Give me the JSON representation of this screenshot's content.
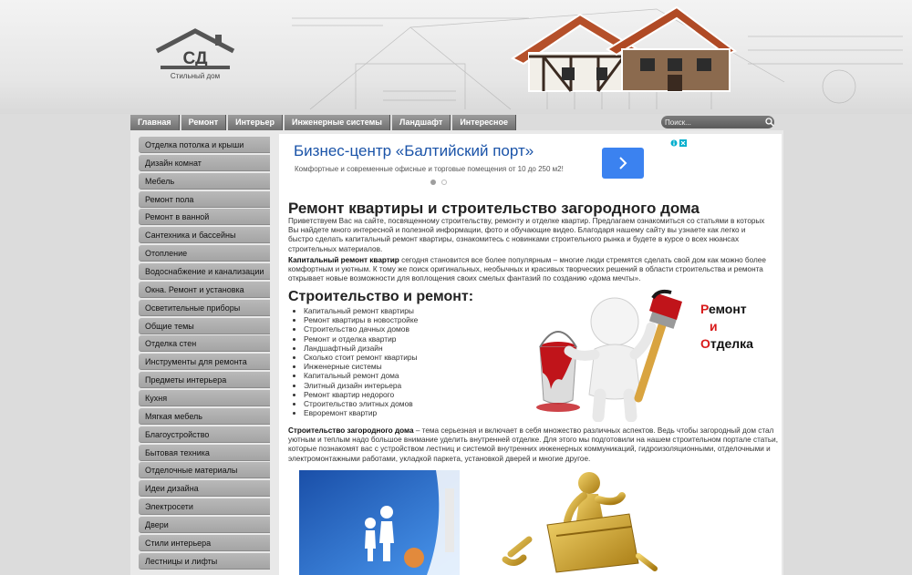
{
  "logo": {
    "text": "Стильный дом",
    "initials": "СД"
  },
  "nav": {
    "items": [
      "Главная",
      "Ремонт",
      "Интерьер",
      "Инженерные системы",
      "Ландшафт",
      "Интересное"
    ]
  },
  "search": {
    "placeholder": "Поиск..."
  },
  "sidebar": {
    "items": [
      "Отделка потолка и крыши",
      "Дизайн комнат",
      "Мебель",
      "Ремонт пола",
      "Ремонт в ванной",
      "Сантехника и бассейны",
      "Отопление",
      "Водоснабжение и канализации",
      "Окна. Ремонт и установка",
      "Осветительные приборы",
      "Общие темы",
      "Отделка стен",
      "Инструменты для ремонта",
      "Предметы интерьера",
      "Кухня",
      "Мягкая мебель",
      "Благоустройство",
      "Бытовая техника",
      "Отделочные материалы",
      "Идеи дизайна",
      "Электросети",
      "Двери",
      "Стили интерьера",
      "Лестницы и лифты"
    ]
  },
  "ad": {
    "title": "Бизнес-центр «Балтийский порт»",
    "description": "Комфортные и современные офисные и торговые помещения от 10 до 250 м2!"
  },
  "article": {
    "title": "Ремонт квартиры и строительство загородного дома",
    "intro": " Приветствуем Вас на сайте, посвященному строительству, ремонту и отделке квартир. Предлагаем ознакомиться со статьями в которых Вы найдете много интересной и полезной информации, фото и обучающие видео. Благодаря нашему сайту вы узнаете как легко и быстро сделать капитальный ремонт квартиры, ознакомитесь с новинками строительного рынка и будете в курсе о всех нюансах строительных материалов.",
    "p2_bold": "Капитальный ремонт квартир",
    "p2_text": " сегодня становится все более популярным – многие люди стремятся сделать свой дом как можно более комфортным и уютным. К тому же поиск оригинальных, необычных и красивых творческих решений в области строительства и ремонта открывает новые возможности для воплощения своих смелых фантазий по созданию «дома мечты».",
    "section_title": "Строительство и ремонт:",
    "links": [
      "Капитальный ремонт квартиры",
      "Ремонт квартиры в новостройке",
      "Строительство дачных домов",
      "Ремонт и отделка квартир",
      "Ландшафтный дизайн",
      "Сколько стоит ремонт квартиры",
      "Инженерные системы",
      "Капитальный ремонт дома",
      "Элитный дизайн интерьера",
      "Ремонт квартир недорого",
      "Строительство элитных домов",
      "Евроремонт квартир"
    ],
    "p3_bold": "Строительство загородного дома",
    "p3_text": "– тема серьезная и включает в себя множество различных аспектов. Ведь чтобы загородный дом стал уютным и теплым надо большое внимание уделить внутренней отделке. Для этого мы подготовили на нашем строительном портале статьи, которые познакомят вас с устройством лестниц и системой внутренних инженерных коммуникаций, гидроизоляционными, отделочными и электромонтажными работами, укладкой паркета, установкой дверей и многие другое."
  },
  "illustration_label": {
    "r": "Р",
    "line1": "емонт",
    "i": "и",
    "o": "О",
    "line3": "тделка"
  },
  "colors": {
    "accent_blue": "#1a53a8",
    "ad_button": "#3b82f0",
    "brush_red": "#d81b1b",
    "nav_bg": "#7f7f7f",
    "sidebar_bg": "#b0b0b0"
  }
}
